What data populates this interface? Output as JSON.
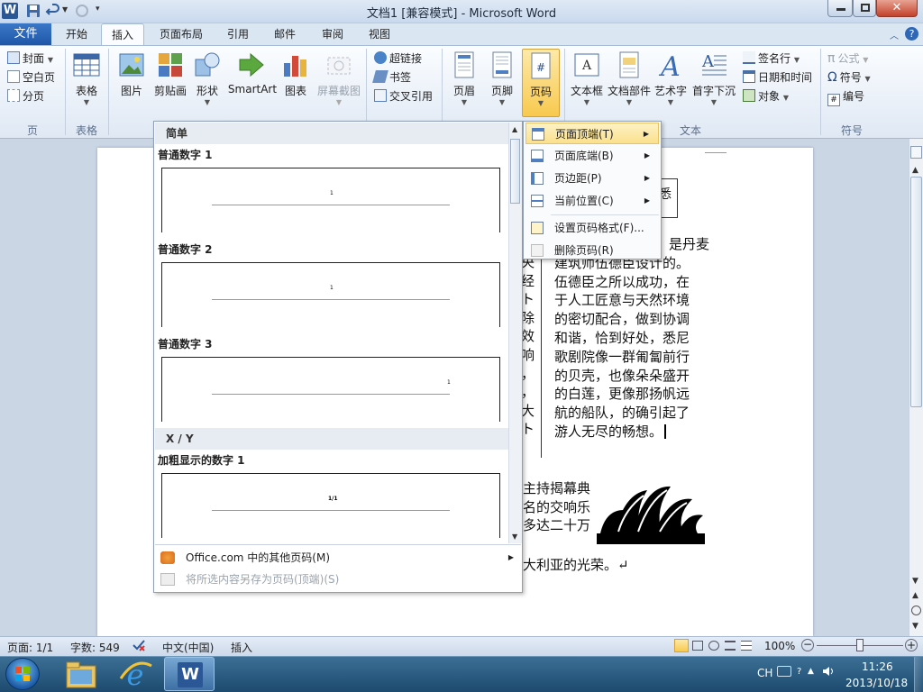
{
  "window": {
    "title": "文档1 [兼容模式] - Microsoft Word"
  },
  "ribbon_tabs": {
    "file": "文件",
    "items": [
      "开始",
      "插入",
      "页面布局",
      "引用",
      "邮件",
      "审阅",
      "视图"
    ],
    "active": "插入"
  },
  "ribbon": {
    "pages": {
      "cover": "封面",
      "blank": "空白页",
      "break": "分页",
      "group": "页"
    },
    "tables": {
      "table": "表格",
      "group": "表格"
    },
    "illustrations": {
      "picture": "图片",
      "clipart": "剪贴画",
      "shapes": "形状",
      "smartart": "SmartArt",
      "chart": "图表",
      "screenshot": "屏幕截图"
    },
    "links": {
      "hyperlink": "超链接",
      "bookmark": "书签",
      "crossref": "交叉引用"
    },
    "headerfooter": {
      "header": "页眉",
      "footer": "页脚",
      "pagenumber": "页码"
    },
    "text": {
      "textbox": "文本框",
      "quickparts": "文档部件",
      "wordart": "艺术字",
      "dropcap": "首字下沉",
      "signature": "签名行",
      "datetime": "日期和时间",
      "object": "对象",
      "group": "文本"
    },
    "symbols": {
      "equation": "公式",
      "symbol": "符号",
      "number": "编号",
      "group": "符号"
    }
  },
  "gallery": {
    "header_simple": "简单",
    "items": [
      {
        "label": "普通数字 1",
        "num": "1"
      },
      {
        "label": "普通数字 2",
        "num": "1"
      },
      {
        "label": "普通数字 3",
        "num": "1"
      }
    ],
    "header_xy": "X / Y",
    "bold_item": {
      "label": "加粗显示的数字 1",
      "num": "1/1"
    },
    "more": "Office.com 中的其他页码(M)",
    "save": "将所选内容另存为页码(顶端)(S)"
  },
  "submenu": {
    "items": [
      "页面顶端(T)",
      "页面底端(B)",
      "页边距(P)",
      "当前位置(C)",
      "设置页码格式(F)...",
      "删除页码(R)"
    ]
  },
  "document": {
    "box_text": "悉",
    "col_right": [
      "是丹麦",
      "建筑师伍德臣设计的。",
      "伍德臣之所以成功，在",
      "于人工匠意与天然环境",
      "的密切配合，做到协调",
      "和谐，恰到好处，悉尼",
      "歌剧院像一群匍匐前行",
      "的贝壳，也像朵朵盛开",
      "的白莲，更像那扬帆远",
      "航的船队，的确引起了",
      "游人无尽的畅想。"
    ],
    "col_left_frag": [
      "央",
      "经",
      "ト",
      "除",
      "效",
      "响",
      "，",
      "，",
      "大",
      "ト"
    ],
    "lower": [
      "主持揭幕典",
      "名的交响乐",
      "多达二十万"
    ],
    "last": "大利亚的光荣。↵"
  },
  "status": {
    "page": "页面: 1/1",
    "words": "字数: 549",
    "lang": "中文(中国)",
    "mode": "插入",
    "zoom": "100%"
  },
  "taskbar": {
    "ime": "CH",
    "time": "11:26",
    "date": "2013/10/18"
  }
}
